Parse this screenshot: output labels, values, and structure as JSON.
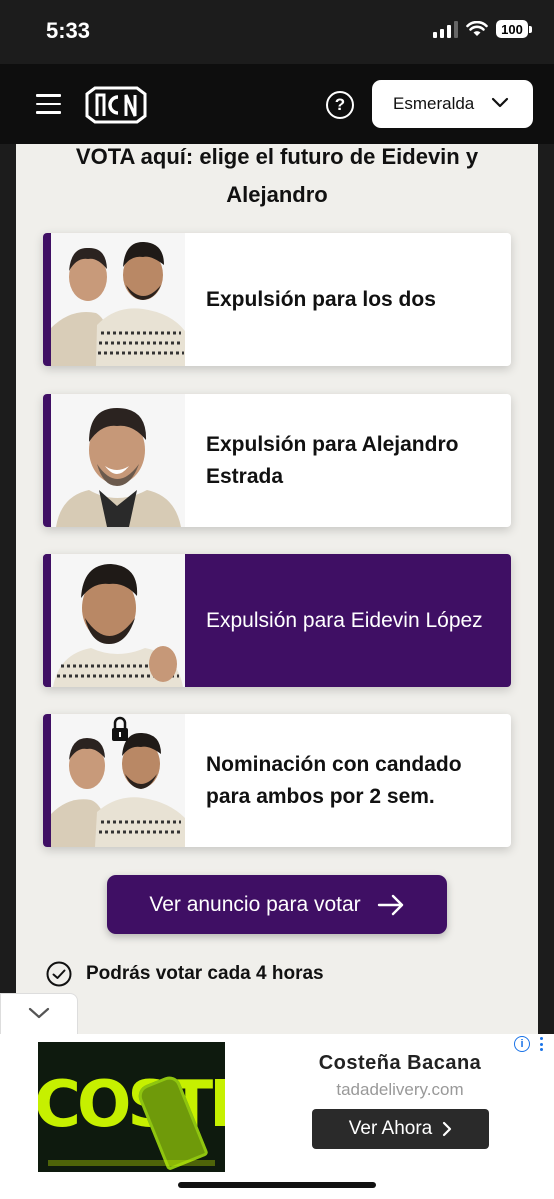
{
  "status_bar": {
    "time": "5:33",
    "battery": "100"
  },
  "header": {
    "region_select": "Esmeralda"
  },
  "vote": {
    "title_line1": "VOTA aquí: elige el futuro de Eidevin y",
    "title_line2": "Alejandro",
    "options": [
      {
        "label": "Expulsión para los dos",
        "selected": false
      },
      {
        "label": "Expulsión para Alejandro Estrada",
        "selected": false
      },
      {
        "label": "Expulsión para Eidevin López",
        "selected": true
      },
      {
        "label": "Nominación con candado para ambos por 2 sem.",
        "selected": false
      }
    ],
    "cta_label": "Ver anuncio para votar",
    "info_text": "Podrás votar cada 4 horas"
  },
  "ad": {
    "brand_image_text": "COSTEÑA",
    "title": "Costeña Bacana",
    "url": "tadadelivery.com",
    "button_label": "Ver Ahora"
  },
  "colors": {
    "accent": "#3f0f64",
    "header_bg": "#0e0e0e",
    "content_bg": "#f0efeb"
  }
}
